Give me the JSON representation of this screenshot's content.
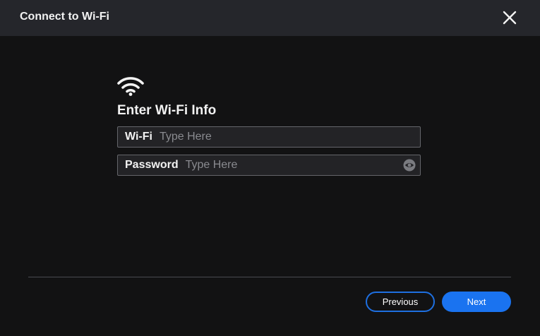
{
  "dialog": {
    "title": "Connect to Wi-Fi",
    "close_icon": "close-icon"
  },
  "main": {
    "icon": "wifi-icon",
    "heading": "Enter Wi-Fi Info",
    "wifi_field": {
      "label": "Wi-Fi",
      "value": "",
      "placeholder": "Type Here"
    },
    "password_field": {
      "label": "Password",
      "value": "",
      "placeholder": "Type Here",
      "toggle_icon": "eye-icon"
    }
  },
  "footer": {
    "previous_label": "Previous",
    "next_label": "Next"
  },
  "colors": {
    "background": "#121213",
    "titlebar": "#25262b",
    "accent": "#1a73f0",
    "text": "#f2f2f2",
    "placeholder": "#8a8b90"
  }
}
